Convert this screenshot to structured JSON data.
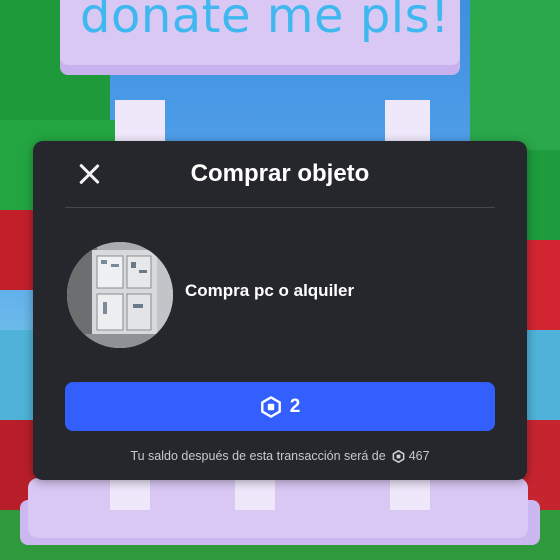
{
  "background": {
    "sign_text": "donate me pls!"
  },
  "dialog": {
    "title": "Comprar objeto",
    "close_icon": "close-icon",
    "item": {
      "name": "Compra pc o alquiler",
      "thumbnail_icon": "item-thumbnail"
    },
    "buy_button": {
      "icon": "robux-icon",
      "price": "2"
    },
    "balance_note": {
      "text": "Tu saldo después de esta transacción será de",
      "icon": "robux-icon",
      "amount": "467"
    }
  },
  "colors": {
    "dialog_bg": "#25272c",
    "buy_button": "#335fff",
    "sign_text": "#3fb8f0"
  }
}
